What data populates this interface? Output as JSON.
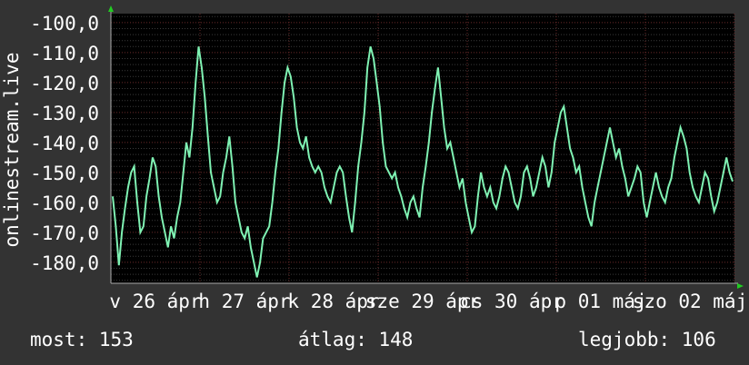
{
  "chart_data": {
    "type": "line",
    "ylabel": "onlinestream.live",
    "ylim": [
      -187,
      -97
    ],
    "y_ticks": [
      -100,
      -110,
      -120,
      -130,
      -140,
      -150,
      -160,
      -170,
      -180
    ],
    "y_tick_labels": [
      "-100,0",
      "-110,0",
      "-120,0",
      "-130,0",
      "-140,0",
      "-150,0",
      "-160,0",
      "-170,0",
      "-180,0"
    ],
    "x_tick_labels": [
      "v 26 ápr",
      "h 27 ápr",
      "k 28 ápr",
      "sze 29 ápr",
      "cs 30 ápr",
      "p 01 máj",
      "szo 02 máj"
    ],
    "grid": true,
    "line_color": "#7ff2b3",
    "series": [
      {
        "values": [
          -158,
          -168,
          -181,
          -170,
          -162,
          -155,
          -150,
          -148,
          -160,
          -170,
          -168,
          -158,
          -152,
          -145,
          -148,
          -158,
          -165,
          -170,
          -175,
          -168,
          -172,
          -165,
          -160,
          -150,
          -140,
          -145,
          -135,
          -120,
          -108,
          -115,
          -125,
          -138,
          -150,
          -155,
          -160,
          -158,
          -150,
          -145,
          -138,
          -148,
          -160,
          -165,
          -170,
          -172,
          -168,
          -175,
          -180,
          -185,
          -180,
          -172,
          -170,
          -168,
          -160,
          -150,
          -142,
          -130,
          -120,
          -115,
          -118,
          -125,
          -135,
          -140,
          -142,
          -138,
          -145,
          -148,
          -150,
          -148,
          -150,
          -155,
          -158,
          -160,
          -155,
          -150,
          -148,
          -150,
          -158,
          -165,
          -170,
          -160,
          -148,
          -140,
          -130,
          -115,
          -108,
          -112,
          -120,
          -128,
          -140,
          -148,
          -150,
          -152,
          -150,
          -155,
          -158,
          -162,
          -165,
          -160,
          -158,
          -162,
          -165,
          -155,
          -148,
          -140,
          -130,
          -122,
          -115,
          -125,
          -135,
          -142,
          -140,
          -145,
          -150,
          -155,
          -152,
          -160,
          -165,
          -170,
          -168,
          -158,
          -150,
          -155,
          -158,
          -155,
          -160,
          -162,
          -158,
          -152,
          -148,
          -150,
          -155,
          -160,
          -162,
          -158,
          -150,
          -148,
          -152,
          -158,
          -155,
          -150,
          -145,
          -148,
          -155,
          -150,
          -140,
          -135,
          -130,
          -128,
          -135,
          -142,
          -145,
          -150,
          -148,
          -155,
          -160,
          -165,
          -168,
          -160,
          -155,
          -150,
          -145,
          -140,
          -135,
          -140,
          -145,
          -142,
          -148,
          -152,
          -158,
          -155,
          -152,
          -148,
          -150,
          -160,
          -165,
          -160,
          -155,
          -150,
          -155,
          -158,
          -160,
          -155,
          -152,
          -145,
          -140,
          -135,
          -138,
          -142,
          -150,
          -155,
          -158,
          -160,
          -155,
          -150,
          -152,
          -158,
          -163,
          -160,
          -155,
          -150,
          -145,
          -150,
          -153
        ]
      }
    ]
  },
  "stats": {
    "now": "most: 153",
    "average": "átlag: 148",
    "best": "legjobb: 106"
  }
}
